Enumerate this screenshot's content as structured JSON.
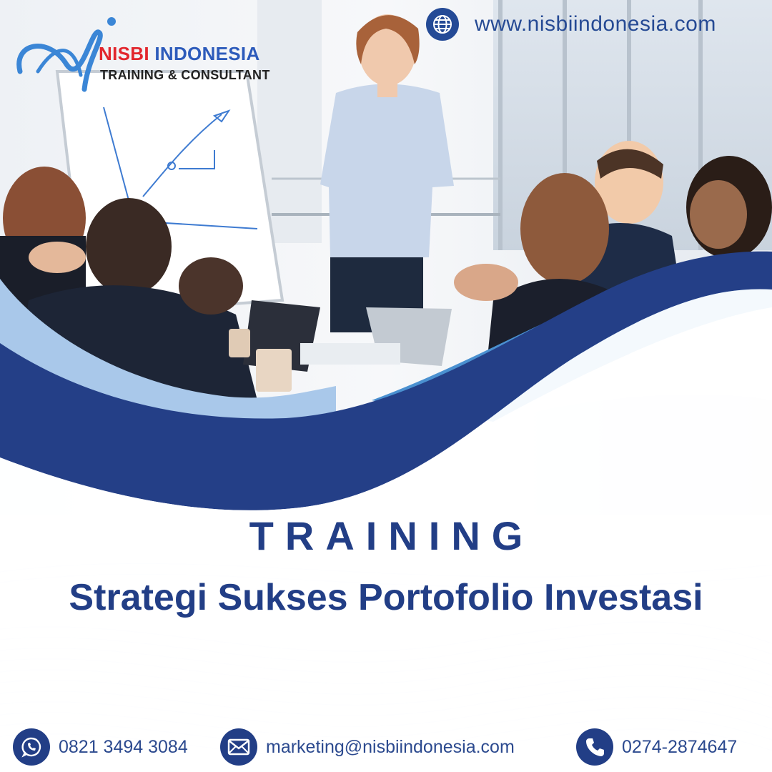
{
  "brand": {
    "name_part1": "NISBI",
    "name_part2": " INDONESIA",
    "tagline": "TRAINING & CONSULTANT",
    "colors": {
      "primary": "#2d5bbb",
      "accent": "#e2262d"
    }
  },
  "website": {
    "icon": "globe-icon",
    "url": "www.nisbiindonesia.com"
  },
  "title": {
    "kicker": "TRAINING",
    "main": "Strategi Sukses Portofolio Investasi"
  },
  "contacts": [
    {
      "icon": "whatsapp-icon",
      "text": "0821 3494 3084"
    },
    {
      "icon": "mail-icon",
      "text": "marketing@nisbiindonesia.com"
    },
    {
      "icon": "phone-icon",
      "text": "0274-2874647"
    }
  ],
  "colors": {
    "navy": "#223e86",
    "mid_blue": "#4a90d0",
    "light_blue": "#a9c8ea"
  }
}
